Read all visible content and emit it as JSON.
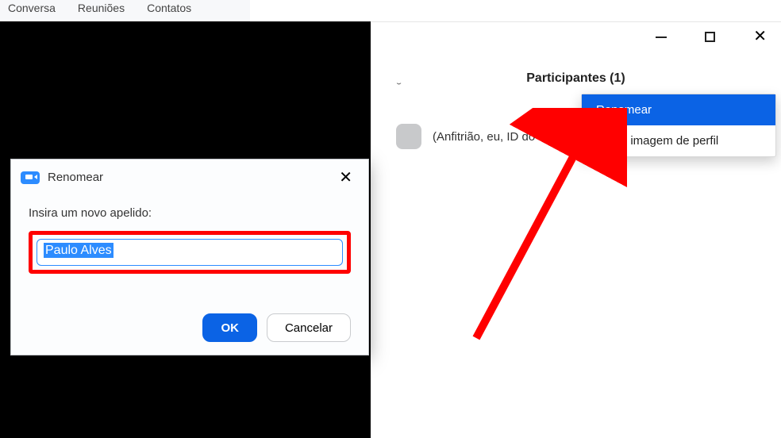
{
  "tabs": {
    "conversa": "Conversa",
    "reunioes": "Reuniões",
    "contatos": "Contatos"
  },
  "panel": {
    "title": "Participantes (1)",
    "participant_label": "(Anfitrião, eu, ID do"
  },
  "context_menu": {
    "rename": "Renomear",
    "edit_profile_image": "Editar imagem de perfil"
  },
  "dialog": {
    "title": "Renomear",
    "prompt": "Insira um novo apelido:",
    "value": "Paulo Alves",
    "ok": "OK",
    "cancel": "Cancelar"
  }
}
